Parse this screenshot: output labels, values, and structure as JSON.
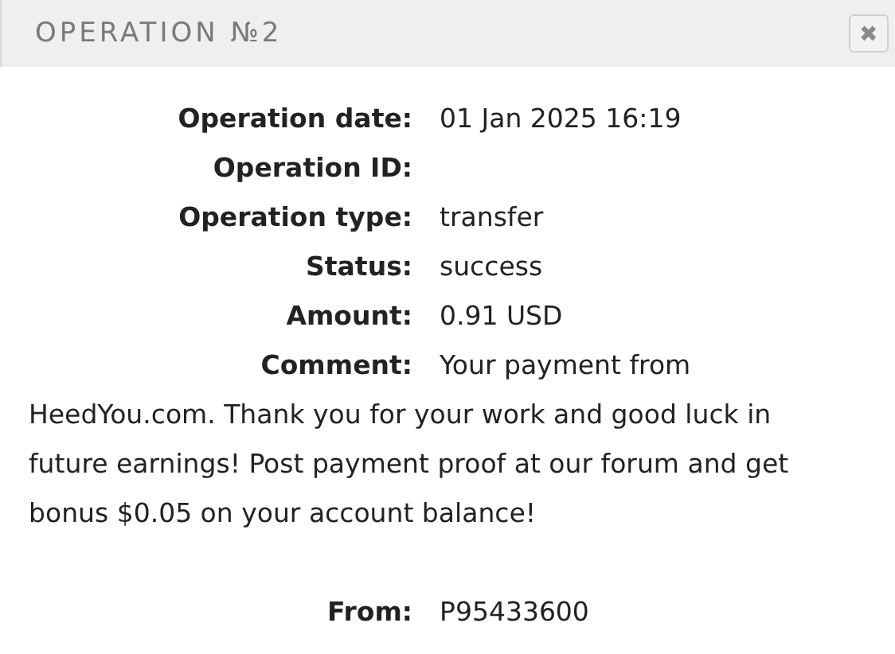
{
  "dialog": {
    "title": "OPERATION №2",
    "close": "✖"
  },
  "fields": [
    {
      "label": "Operation date:",
      "value": "01 Jan 2025 16:19"
    },
    {
      "label": "Operation ID:"
    },
    {
      "label": "Operation type:",
      "value": "transfer"
    },
    {
      "label": "Status:",
      "value": "success"
    },
    {
      "label": "Amount:",
      "value": "0.91 USD"
    }
  ],
  "comment": {
    "label": "Comment:",
    "value": "Your payment from",
    "continued": "HeedYou.com. Thank you for your work and good luck in future earnings! Post payment proof at our forum and get bonus $0.05 on your account balance!"
  },
  "from": {
    "label": "From:",
    "value": "P95433600"
  }
}
